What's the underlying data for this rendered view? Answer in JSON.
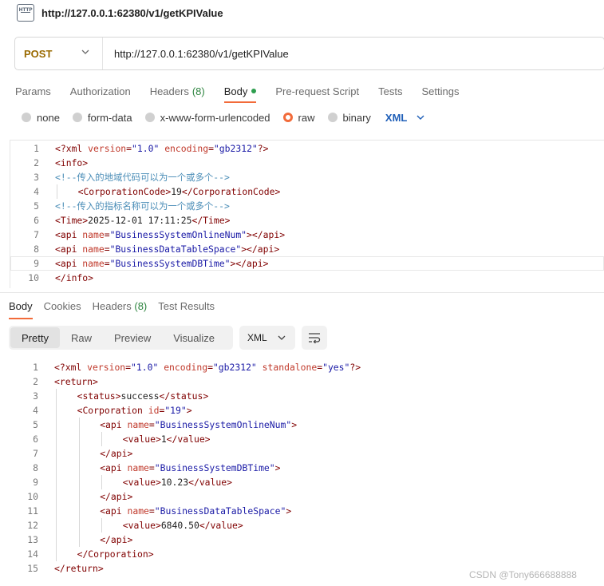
{
  "title_bar": {
    "icon_label": "HTTP",
    "title": "http://127.0.0.1:62380/v1/getKPIValue"
  },
  "request": {
    "method": "POST",
    "url": "http://127.0.0.1:62380/v1/getKPIValue",
    "tabs": [
      {
        "label": "Params"
      },
      {
        "label": "Authorization"
      },
      {
        "label": "Headers",
        "count": "(8)"
      },
      {
        "label": "Body"
      },
      {
        "label": "Pre-request Script"
      },
      {
        "label": "Tests"
      },
      {
        "label": "Settings"
      }
    ],
    "body_types": [
      "none",
      "form-data",
      "x-www-form-urlencoded",
      "raw",
      "binary"
    ],
    "selected_body_type": "raw",
    "format": "XML",
    "lines": [
      {
        "n": "1",
        "indent": 0,
        "parts": [
          [
            "decl",
            "<?xml "
          ],
          [
            "attr",
            "version"
          ],
          [
            "decl",
            "="
          ],
          [
            "val",
            "\"1.0\""
          ],
          [
            "decl",
            " "
          ],
          [
            "attr",
            "encoding"
          ],
          [
            "decl",
            "="
          ],
          [
            "val",
            "\"gb2312\""
          ],
          [
            "decl",
            "?>"
          ]
        ]
      },
      {
        "n": "2",
        "indent": 0,
        "parts": [
          [
            "tag",
            "<info>"
          ]
        ]
      },
      {
        "n": "3",
        "indent": 0,
        "parts": [
          [
            "comment",
            "<!--传入的地域代码可以为一个或多个-->"
          ]
        ]
      },
      {
        "n": "4",
        "indent": 1,
        "parts": [
          [
            "tag",
            "<CorporationCode>"
          ],
          [
            "text",
            "19"
          ],
          [
            "tag",
            "</CorporationCode>"
          ]
        ]
      },
      {
        "n": "5",
        "indent": 0,
        "parts": [
          [
            "comment",
            "<!--传入的指标名称可以为一个或多个-->"
          ]
        ]
      },
      {
        "n": "6",
        "indent": 0,
        "parts": [
          [
            "tag",
            "<Time>"
          ],
          [
            "text",
            "2025-12-01 17:11:25"
          ],
          [
            "tag",
            "</Time>"
          ]
        ]
      },
      {
        "n": "7",
        "indent": 0,
        "parts": [
          [
            "tag",
            "<api "
          ],
          [
            "attr",
            "name"
          ],
          [
            "tag",
            "="
          ],
          [
            "val",
            "\"BusinessSystemOnlineNum\""
          ],
          [
            "tag",
            "></api>"
          ]
        ]
      },
      {
        "n": "8",
        "indent": 0,
        "parts": [
          [
            "tag",
            "<api "
          ],
          [
            "attr",
            "name"
          ],
          [
            "tag",
            "="
          ],
          [
            "val",
            "\"BusinessDataTableSpace\""
          ],
          [
            "tag",
            "></api>"
          ]
        ]
      },
      {
        "n": "9",
        "indent": 0,
        "parts": [
          [
            "tag",
            "<api "
          ],
          [
            "attr",
            "name"
          ],
          [
            "tag",
            "="
          ],
          [
            "val",
            "\"BusinessSystemDBTime\""
          ],
          [
            "tag",
            "></api>"
          ]
        ]
      },
      {
        "n": "10",
        "indent": 0,
        "parts": [
          [
            "tag",
            "</info>"
          ]
        ]
      }
    ]
  },
  "response": {
    "tabs": [
      {
        "label": "Body"
      },
      {
        "label": "Cookies"
      },
      {
        "label": "Headers ",
        "count": "(8)"
      },
      {
        "label": "Test Results"
      }
    ],
    "views": [
      "Pretty",
      "Raw",
      "Preview",
      "Visualize"
    ],
    "selected_view": "Pretty",
    "format": "XML",
    "lines": [
      {
        "n": "1",
        "indent": 0,
        "parts": [
          [
            "decl",
            "<?xml "
          ],
          [
            "attr",
            "version"
          ],
          [
            "decl",
            "="
          ],
          [
            "val",
            "\"1.0\""
          ],
          [
            "decl",
            " "
          ],
          [
            "attr",
            "encoding"
          ],
          [
            "decl",
            "="
          ],
          [
            "val",
            "\"gb2312\""
          ],
          [
            "decl",
            " "
          ],
          [
            "attr",
            "standalone"
          ],
          [
            "decl",
            "="
          ],
          [
            "val",
            "\"yes\""
          ],
          [
            "decl",
            "?>"
          ]
        ]
      },
      {
        "n": "2",
        "indent": 0,
        "parts": [
          [
            "tag",
            "<return>"
          ]
        ]
      },
      {
        "n": "3",
        "indent": 1,
        "parts": [
          [
            "tag",
            "<status>"
          ],
          [
            "text",
            "success"
          ],
          [
            "tag",
            "</status>"
          ]
        ]
      },
      {
        "n": "4",
        "indent": 1,
        "parts": [
          [
            "tag",
            "<Corporation "
          ],
          [
            "attr",
            "id"
          ],
          [
            "tag",
            "="
          ],
          [
            "val",
            "\"19\""
          ],
          [
            "tag",
            ">"
          ]
        ]
      },
      {
        "n": "5",
        "indent": 2,
        "parts": [
          [
            "tag",
            "<api "
          ],
          [
            "attr",
            "name"
          ],
          [
            "tag",
            "="
          ],
          [
            "val",
            "\"BusinessSystemOnlineNum\""
          ],
          [
            "tag",
            ">"
          ]
        ]
      },
      {
        "n": "6",
        "indent": 3,
        "parts": [
          [
            "tag",
            "<value>"
          ],
          [
            "text",
            "1"
          ],
          [
            "tag",
            "</value>"
          ]
        ]
      },
      {
        "n": "7",
        "indent": 2,
        "parts": [
          [
            "tag",
            "</api>"
          ]
        ]
      },
      {
        "n": "8",
        "indent": 2,
        "parts": [
          [
            "tag",
            "<api "
          ],
          [
            "attr",
            "name"
          ],
          [
            "tag",
            "="
          ],
          [
            "val",
            "\"BusinessSystemDBTime\""
          ],
          [
            "tag",
            ">"
          ]
        ]
      },
      {
        "n": "9",
        "indent": 3,
        "parts": [
          [
            "tag",
            "<value>"
          ],
          [
            "text",
            "10.23"
          ],
          [
            "tag",
            "</value>"
          ]
        ]
      },
      {
        "n": "10",
        "indent": 2,
        "parts": [
          [
            "tag",
            "</api>"
          ]
        ]
      },
      {
        "n": "11",
        "indent": 2,
        "parts": [
          [
            "tag",
            "<api "
          ],
          [
            "attr",
            "name"
          ],
          [
            "tag",
            "="
          ],
          [
            "val",
            "\"BusinessDataTableSpace\""
          ],
          [
            "tag",
            ">"
          ]
        ]
      },
      {
        "n": "12",
        "indent": 3,
        "parts": [
          [
            "tag",
            "<value>"
          ],
          [
            "text",
            "6840.50"
          ],
          [
            "tag",
            "</value>"
          ]
        ]
      },
      {
        "n": "13",
        "indent": 2,
        "parts": [
          [
            "tag",
            "</api>"
          ]
        ]
      },
      {
        "n": "14",
        "indent": 1,
        "parts": [
          [
            "tag",
            "</Corporation>"
          ]
        ]
      },
      {
        "n": "15",
        "indent": 0,
        "parts": [
          [
            "tag",
            "</return>"
          ]
        ]
      }
    ]
  },
  "watermark": "CSDN @Tony666688888",
  "colors": {
    "accent": "#f26b3a",
    "method": "#9a6a00",
    "format_link": "#1f5fb8",
    "count_green": "#2e8540"
  }
}
